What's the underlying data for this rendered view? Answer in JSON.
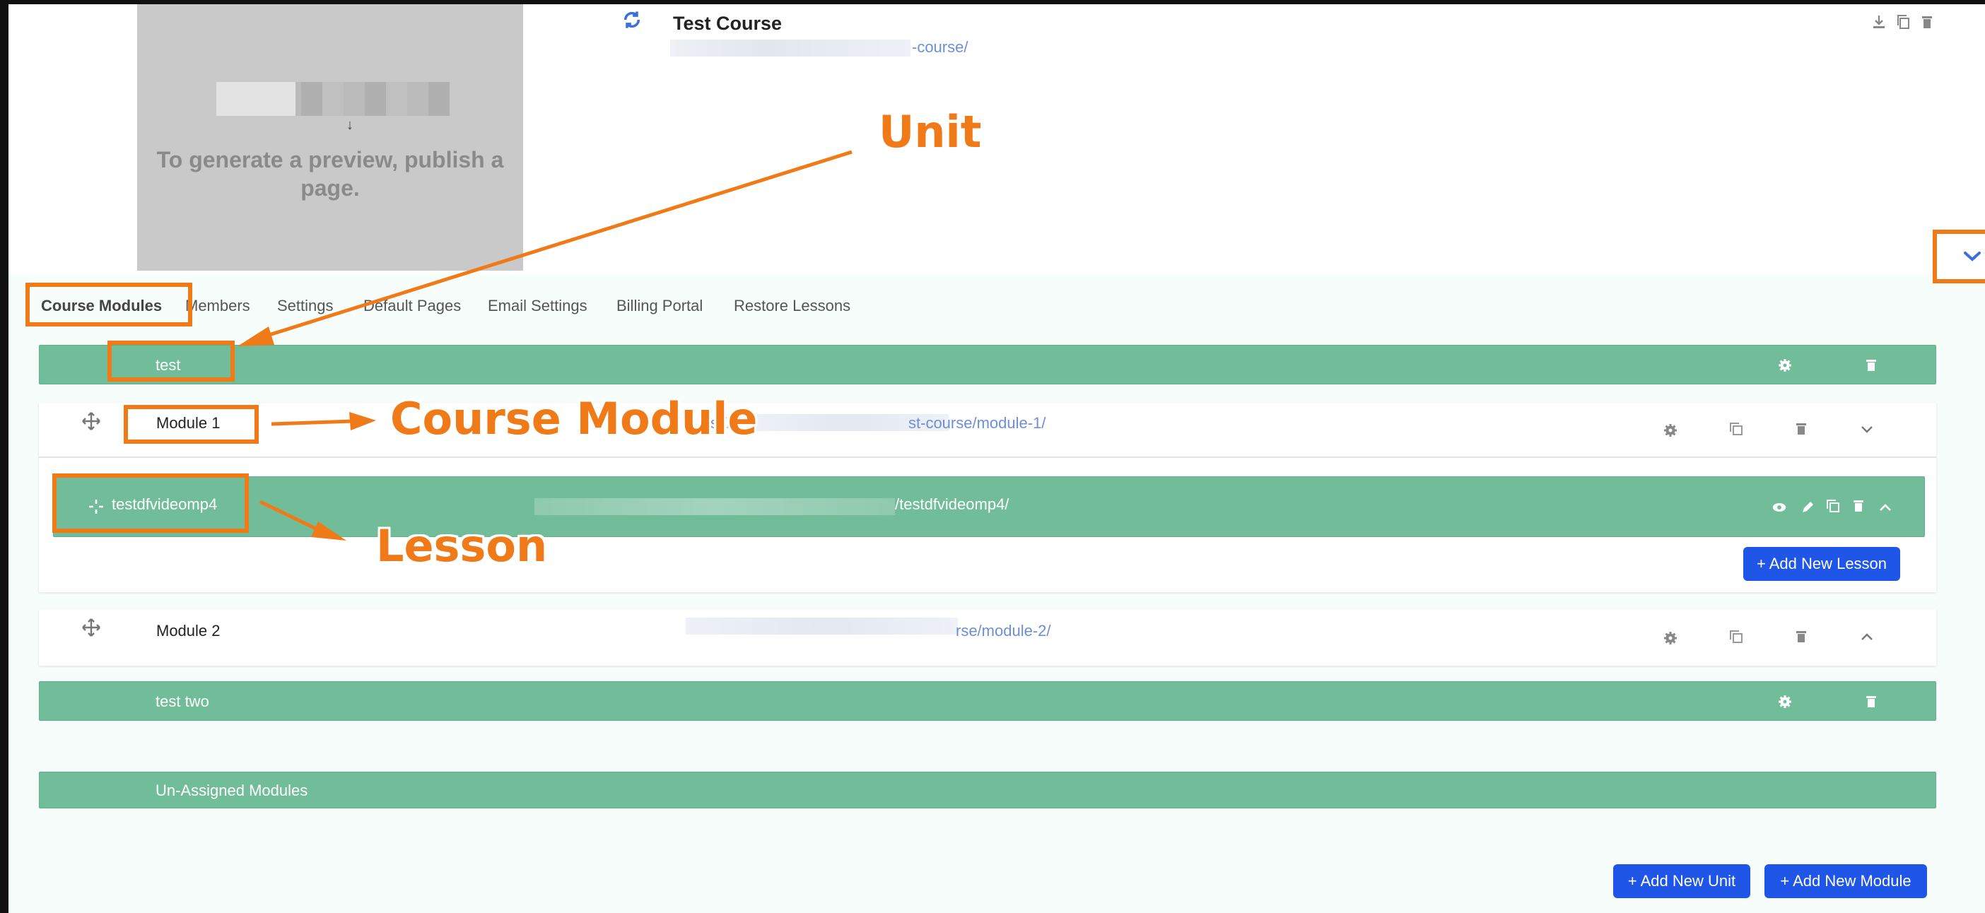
{
  "preview": {
    "message": "To generate a preview, publish a page."
  },
  "header": {
    "title": "Test Course",
    "url_suffix": "-course/",
    "icons": [
      "download-icon",
      "copy-icon",
      "trash-icon"
    ]
  },
  "tabs": [
    {
      "label": "Course Modules",
      "active": true
    },
    {
      "label": "Members"
    },
    {
      "label": "Settings"
    },
    {
      "label": "Default Pages"
    },
    {
      "label": "Email Settings"
    },
    {
      "label": "Billing Portal"
    },
    {
      "label": "Restore Lessons"
    }
  ],
  "units": [
    {
      "label": "test"
    },
    {
      "label": "test two"
    }
  ],
  "modules": [
    {
      "title": "Module 1",
      "url_prefix": "s://t",
      "url_suffix": "st-course/module-1/",
      "expanded": true
    },
    {
      "title": "Module 2",
      "url_suffix": "rse/module-2/",
      "expanded": false
    }
  ],
  "lesson": {
    "title": "testdfvideomp4",
    "url_suffix": "/testdfvideomp4/"
  },
  "unassigned": {
    "label": "Un-Assigned Modules"
  },
  "buttons": {
    "add_lesson": "+ Add New Lesson",
    "add_unit": "+ Add New Unit",
    "add_module": "+ Add New Module"
  },
  "annotations": {
    "unit": "Unit",
    "course_module": "Course Module",
    "lesson": "Lesson"
  },
  "colors": {
    "accent_orange": "#f07a18",
    "unit_green": "#72bd99",
    "button_blue": "#1f56e8",
    "link_blue": "#6c8fd6"
  }
}
